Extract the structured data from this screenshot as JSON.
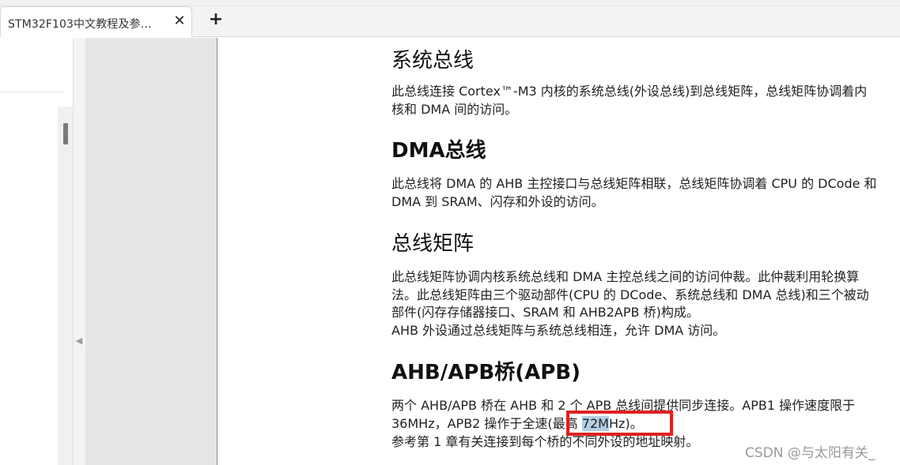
{
  "tab": {
    "title": "STM32F103中文教程及参…",
    "close_label": "✕",
    "new_tab_label": "+"
  },
  "sidebar": {
    "collapse_label": "◀"
  },
  "document": {
    "system_bus": {
      "heading": "系统总线",
      "text": "此总线连接 Cortex™-M3 内核的系统总线(外设总线)到总线矩阵，总线矩阵协调着内核和 DMA 间的访问。"
    },
    "dma_bus": {
      "heading": "DMA总线",
      "text": "此总线将 DMA 的 AHB 主控接口与总线矩阵相联，总线矩阵协调着 CPU 的 DCode 和 DMA 到 SRAM、闪存和外设的访问。"
    },
    "bus_matrix": {
      "heading": "总线矩阵",
      "text1": "此总线矩阵协调内核系统总线和 DMA 主控总线之间的访问仲裁。此仲裁利用轮换算法。此总线矩阵由三个驱动部件(CPU 的 DCode、系统总线和 DMA 总线)和三个被动部件(闪存存储器接口、SRAM 和 AHB2APB 桥)构成。",
      "text2": "AHB 外设通过总线矩阵与系统总线相连，允许 DMA 访问。"
    },
    "ahb_apb": {
      "heading": "AHB/APB桥(APB)",
      "text_before": "两个 AHB/APB 桥在 AHB 和 2 个 APB 总线间提供同步连接。APB1 操作速度限于 36MHz，APB2 操作于全速(最高 ",
      "highlight": "72M",
      "text_after": "Hz)。",
      "text2": "参考第 1 章有关连接到每个桥的不同外设的地址映射。"
    }
  },
  "watermark": "CSDN @与太阳有关_"
}
